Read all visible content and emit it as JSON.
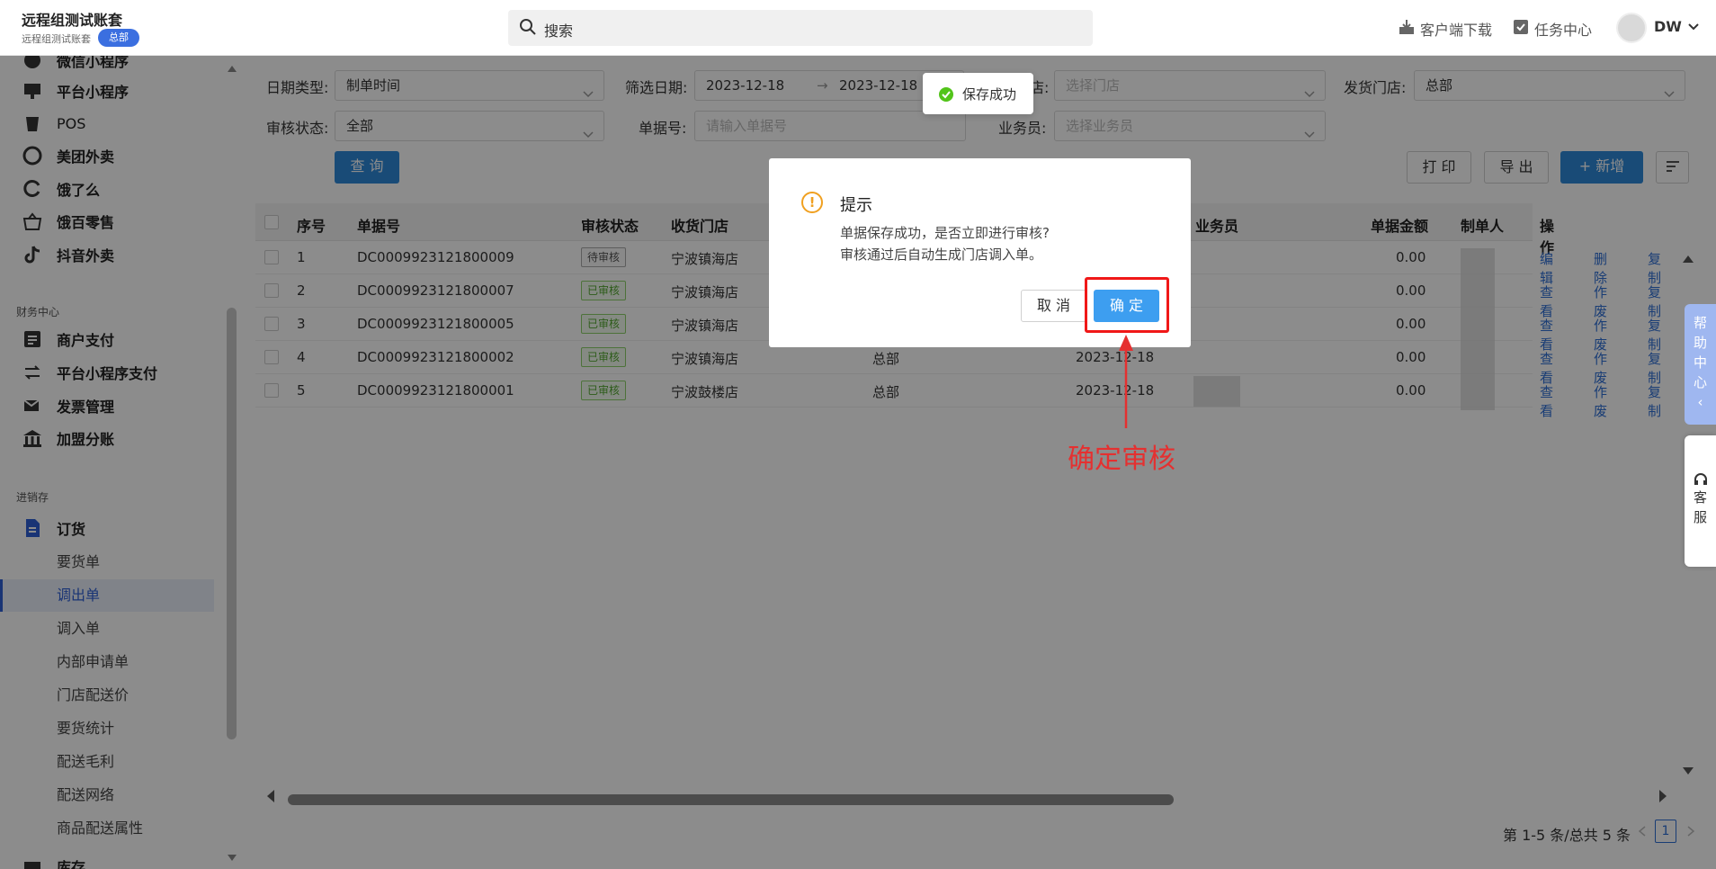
{
  "header": {
    "brand_title": "远程组测试账套",
    "brand_sub": "远程组测试账套",
    "brand_badge": "总部",
    "search_placeholder": "搜索",
    "download_label": "客户端下载",
    "task_label": "任务中心",
    "user_name": "DW"
  },
  "sidebar": {
    "top_items": [
      {
        "label": "微信小程序",
        "icon": "wechat-mini-icon"
      },
      {
        "label": "平台小程序",
        "icon": "platform-mini-icon"
      },
      {
        "label": "POS",
        "icon": "pos-icon"
      },
      {
        "label": "美团外卖",
        "icon": "meituan-icon"
      },
      {
        "label": "饿了么",
        "icon": "eleme-icon"
      },
      {
        "label": "饿百零售",
        "icon": "ebai-icon"
      },
      {
        "label": "抖音外卖",
        "icon": "douyin-icon"
      }
    ],
    "finance_section": "财务中心",
    "finance_items": [
      {
        "label": "商户支付",
        "icon": "merchant-pay-icon"
      },
      {
        "label": "平台小程序支付",
        "icon": "platform-pay-icon"
      },
      {
        "label": "发票管理",
        "icon": "invoice-icon"
      },
      {
        "label": "加盟分账",
        "icon": "bank-icon"
      }
    ],
    "inventory_section": "进销存",
    "order_group": "订货",
    "order_subitems": [
      "要货单",
      "调出单",
      "调入单",
      "内部申请单",
      "门店配送价",
      "要货统计",
      "配送毛利",
      "配送网络",
      "商品配送属性"
    ],
    "active_subitem": "调出单",
    "bottom_item": "库存"
  },
  "filters": {
    "date_type_label": "日期类型:",
    "date_type_value": "制单时间",
    "filter_date_label": "筛选日期:",
    "date_start": "2023-12-18",
    "date_end": "2023-12-18",
    "date_arrow": "→",
    "store_label_partial": "店:",
    "store_placeholder": "选择门店",
    "ship_store_label": "发货门店:",
    "ship_store_value": "总部",
    "audit_label": "审核状态:",
    "audit_value": "全部",
    "docno_label": "单据号:",
    "docno_placeholder": "请输入单据号",
    "sales_label": "业务员:",
    "sales_placeholder": "选择业务员",
    "query_button": "查 询",
    "print_button": "打 印",
    "export_button": "导 出",
    "add_button": "新增"
  },
  "table": {
    "headers": [
      "序号",
      "单据号",
      "审核状态",
      "收货门店",
      "业务员",
      "单据金额",
      "制单人",
      "操作"
    ],
    "rows": [
      {
        "no": "1",
        "docno": "DC0009923121800009",
        "status": "待审核",
        "status_kind": "wait",
        "store": "宁波镇海店",
        "ship": "",
        "date": "",
        "amount": "0.00",
        "ops": [
          "编辑",
          "删除",
          "复制"
        ]
      },
      {
        "no": "2",
        "docno": "DC0009923121800007",
        "status": "已审核",
        "status_kind": "ok",
        "store": "宁波镇海店",
        "ship": "",
        "date": "",
        "amount": "0.00",
        "ops": [
          "查看",
          "作废",
          "复制"
        ]
      },
      {
        "no": "3",
        "docno": "DC0009923121800005",
        "status": "已审核",
        "status_kind": "ok",
        "store": "宁波镇海店",
        "ship": "",
        "date": "",
        "amount": "0.00",
        "ops": [
          "查看",
          "作废",
          "复制"
        ]
      },
      {
        "no": "4",
        "docno": "DC0009923121800002",
        "status": "已审核",
        "status_kind": "ok",
        "store": "宁波镇海店",
        "ship": "总部",
        "date": "2023-12-18",
        "amount": "0.00",
        "ops": [
          "查看",
          "作废",
          "复制"
        ]
      },
      {
        "no": "5",
        "docno": "DC0009923121800001",
        "status": "已审核",
        "status_kind": "ok",
        "store": "宁波鼓楼店",
        "ship": "总部",
        "date": "2023-12-18",
        "amount": "0.00",
        "ops": [
          "查看",
          "作废",
          "复制"
        ]
      }
    ]
  },
  "pagination": {
    "summary": "第 1-5 条/总共 5 条",
    "current_page": "1"
  },
  "floating": {
    "help_chars": [
      "帮",
      "助",
      "中",
      "心",
      "‹"
    ],
    "service_chars": [
      "客",
      "服"
    ]
  },
  "toast": {
    "message": "保存成功"
  },
  "modal": {
    "title": "提示",
    "line1": "单据保存成功，是否立即进行审核?",
    "line2": "审核通过后自动生成门店调入单。",
    "cancel": "取 消",
    "ok": "确 定"
  },
  "annotation": {
    "text": "确定审核",
    "color": "#e53030"
  },
  "colors": {
    "primary": "#2e89d9",
    "link": "#2f6fd6",
    "success": "#52c41a",
    "warning": "#f0a020",
    "highlight": "#f01818"
  }
}
